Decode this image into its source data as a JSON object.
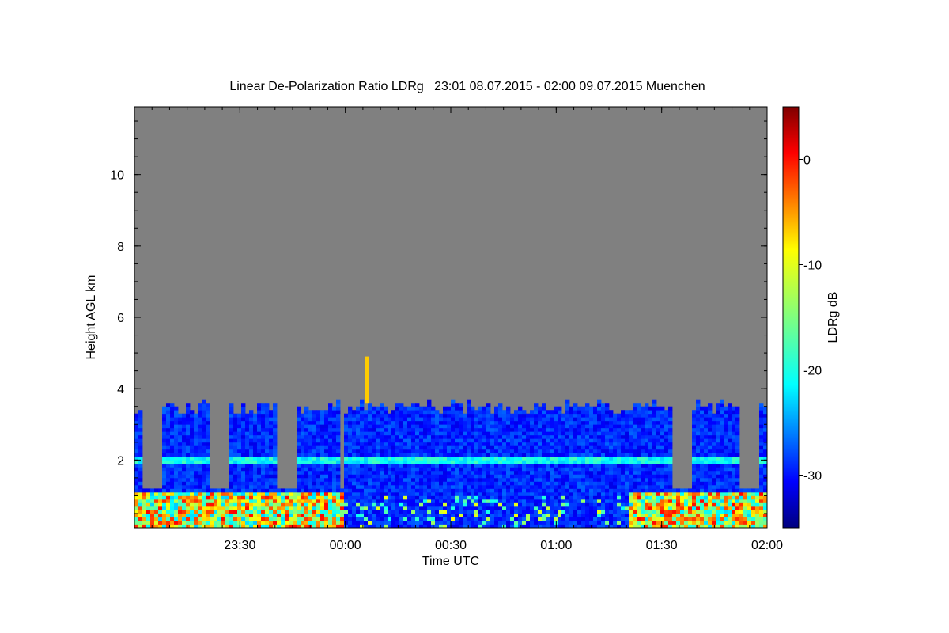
{
  "chart_data": {
    "type": "heatmap",
    "title": "Linear De-Polarization Ratio LDRg   23:01 08.07.2015 - 02:00 09.07.2015 Muenchen",
    "xlabel": "Time UTC",
    "ylabel": "Height AGL km",
    "x_range": [
      "23:01",
      "02:00"
    ],
    "x_ticks": [
      "23:30",
      "00:00",
      "00:30",
      "01:00",
      "01:30",
      "02:00"
    ],
    "ylim": [
      0.1,
      11.9
    ],
    "y_ticks": [
      2,
      4,
      6,
      8,
      10
    ],
    "colorbar": {
      "label": "LDRg dB",
      "range": [
        -35,
        5
      ],
      "ticks": [
        0,
        -10,
        -20,
        -30
      ],
      "colormap": "jet"
    },
    "background_color": "#808080",
    "cloud_top_km": 3.6,
    "depolarization_layer_km": 2.0,
    "elevated_feature": {
      "time": "00:06",
      "bottom_km": 3.6,
      "top_km": 4.9,
      "ldr_db": -8
    }
  }
}
